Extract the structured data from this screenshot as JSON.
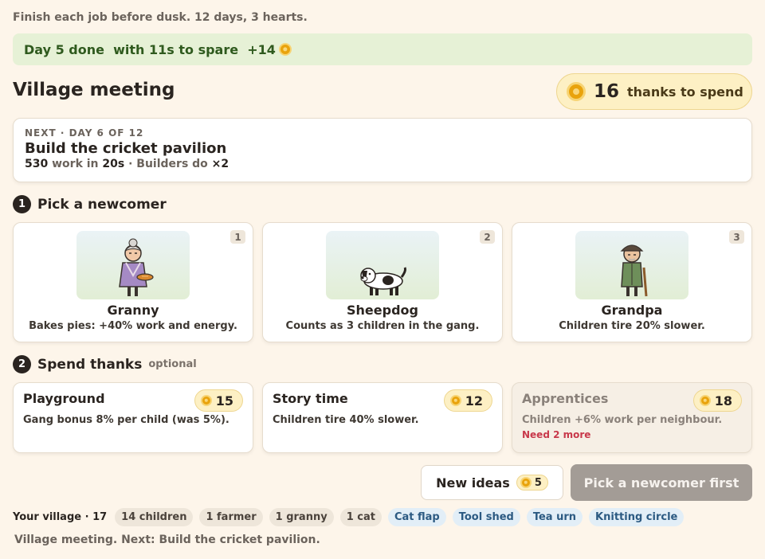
{
  "intro": "Finish each job before dusk. 12 days, 3 hearts.",
  "banner": {
    "text": "Day 5 done  with 11s to spare  +14"
  },
  "header": {
    "title": "Village meeting",
    "thanks_count": "16",
    "thanks_label": "thanks to spend"
  },
  "next": {
    "kicker": "NEXT · DAY 6 OF 12",
    "title": "Build the cricket pavilion",
    "work": "530",
    "work_label": " work in ",
    "time": "20s",
    "builders_label": " · Builders do ",
    "multiplier": "×2"
  },
  "section1": {
    "num": "1",
    "title": "Pick a newcomer"
  },
  "newcomers": [
    {
      "key": "1",
      "name": "Granny",
      "desc": "Bakes pies: +40% work and energy."
    },
    {
      "key": "2",
      "name": "Sheepdog",
      "desc": "Counts as 3 children in the gang."
    },
    {
      "key": "3",
      "name": "Grandpa",
      "desc": "Children tire 20% slower."
    }
  ],
  "section2": {
    "num": "2",
    "title": "Spend thanks",
    "optional": "optional"
  },
  "upgrades": [
    {
      "title": "Playground",
      "cost": "15",
      "desc": "Gang bonus 8% per child (was 5%).",
      "need": ""
    },
    {
      "title": "Story time",
      "cost": "12",
      "desc": "Children tire 40% slower.",
      "need": ""
    },
    {
      "title": "Apprentices",
      "cost": "18",
      "desc": "Children +6% work per neighbour.",
      "need": "Need 2 more"
    }
  ],
  "actions": {
    "new_ideas": "New ideas",
    "new_ideas_cost": "5",
    "pick": "Pick a newcomer first"
  },
  "village": {
    "label": "Your village · 17",
    "members": [
      "14 children",
      "1 farmer",
      "1 granny",
      "1 cat"
    ],
    "perks": [
      "Cat flap",
      "Tool shed",
      "Tea urn",
      "Knitting circle"
    ]
  },
  "status": "Village meeting. Next: Build the cricket pavilion.",
  "colors": {
    "coin": "#e9a30c",
    "banner_bg": "#e6f1d6",
    "accent_dark": "#2a2420",
    "need_red": "#c8384a",
    "perk_blue": "#2c5a82"
  }
}
